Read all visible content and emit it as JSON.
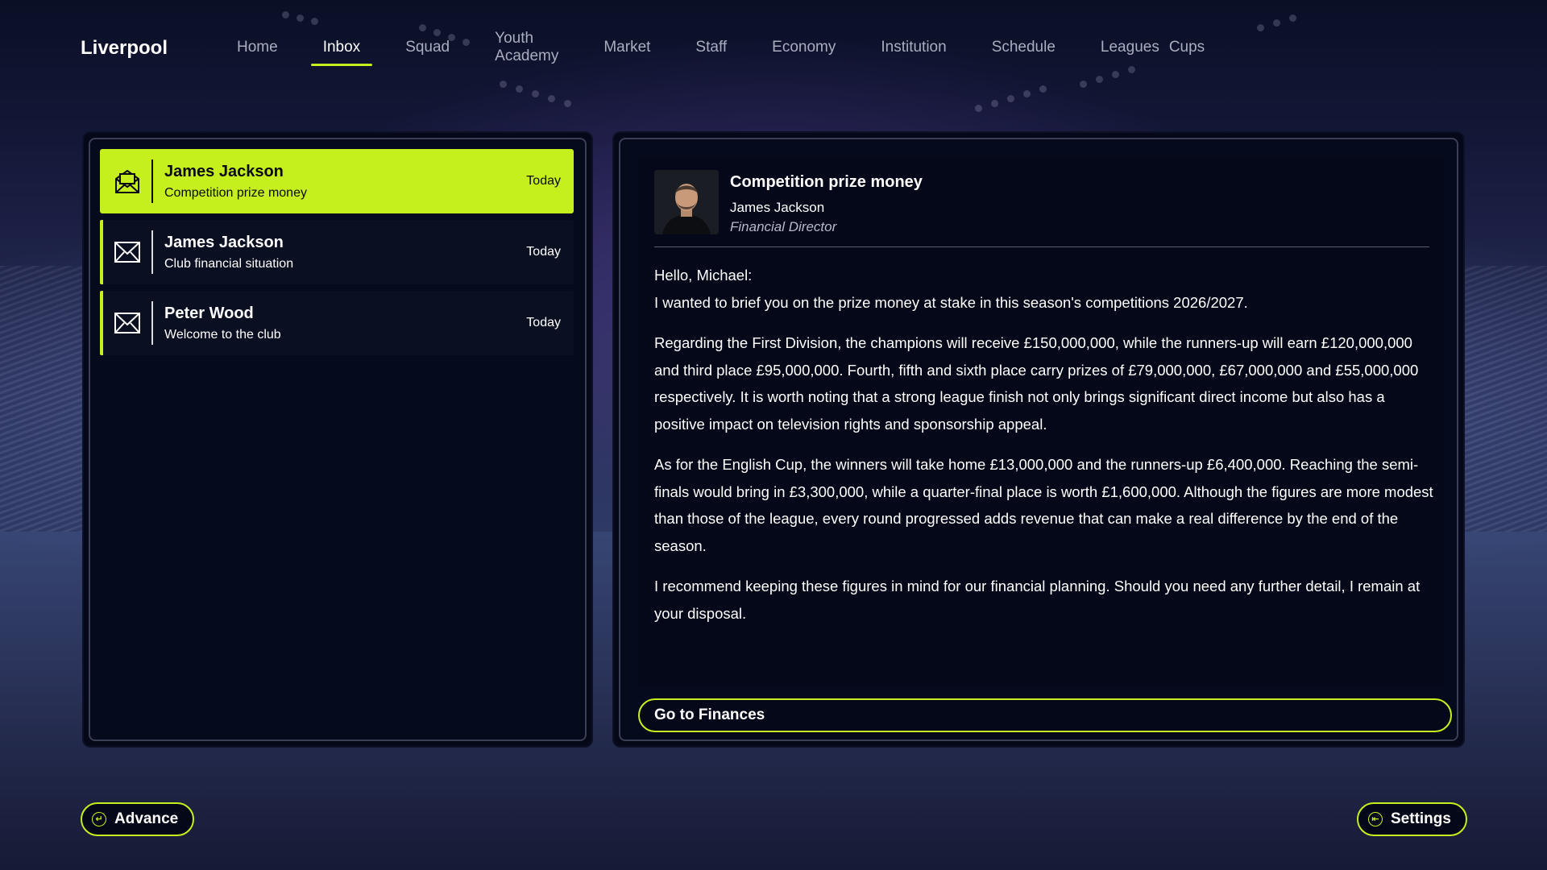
{
  "app": {
    "club_name": "Liverpool"
  },
  "nav": {
    "items": [
      {
        "label": "Home",
        "active": false
      },
      {
        "label": "Inbox",
        "active": true
      },
      {
        "label": "Squad",
        "active": false
      },
      {
        "label": "Youth Academy",
        "active": false
      },
      {
        "label": "Market",
        "active": false
      },
      {
        "label": "Staff",
        "active": false
      },
      {
        "label": "Economy",
        "active": false
      },
      {
        "label": "Institution",
        "active": false
      },
      {
        "label": "Schedule",
        "active": false
      },
      {
        "label": "Leagues",
        "active": false
      },
      {
        "label": "Cups",
        "active": false
      }
    ]
  },
  "inbox": {
    "messages": [
      {
        "sender": "James Jackson",
        "subject": "Competition prize money",
        "date": "Today",
        "selected": true,
        "icon": "envelope-open-icon"
      },
      {
        "sender": "James Jackson",
        "subject": "Club financial situation",
        "date": "Today",
        "selected": false,
        "icon": "envelope-icon"
      },
      {
        "sender": "Peter Wood",
        "subject": "Welcome to the club",
        "date": "Today",
        "selected": false,
        "icon": "envelope-icon"
      }
    ]
  },
  "message": {
    "title": "Competition prize money",
    "from": "James Jackson",
    "role": "Financial Director",
    "avatar_icon": "person-avatar-icon",
    "greeting": "Hello, Michael:",
    "paragraphs": [
      "I wanted to brief you on the prize money at stake in this season's competitions 2026/2027.",
      "Regarding the First Division, the champions will receive £150,000,000, while the runners-up will earn £120,000,000 and third place £95,000,000. Fourth, fifth and sixth place carry prizes of £79,000,000, £67,000,000 and £55,000,000 respectively. It is worth noting that a strong league finish not only brings significant direct income but also has a positive impact on television rights and sponsorship appeal.",
      "As for the English Cup, the winners will take home £13,000,000 and the runners-up £6,400,000. Reaching the semi-finals would bring in £3,300,000, while a quarter-final place is worth £1,600,000. Although the figures are more modest than those of the league, every round progressed adds revenue that can make a real difference by the end of the season.",
      "I recommend keeping these figures in mind for our financial planning. Should you need any further detail, I remain at your disposal."
    ],
    "action_label": "Go to Finances"
  },
  "footer": {
    "advance_label": "Advance",
    "advance_icon": "enter-icon",
    "settings_label": "Settings",
    "settings_icon": "exit-icon"
  },
  "colors": {
    "accent": "#c5f01e",
    "panel": "#050818"
  }
}
